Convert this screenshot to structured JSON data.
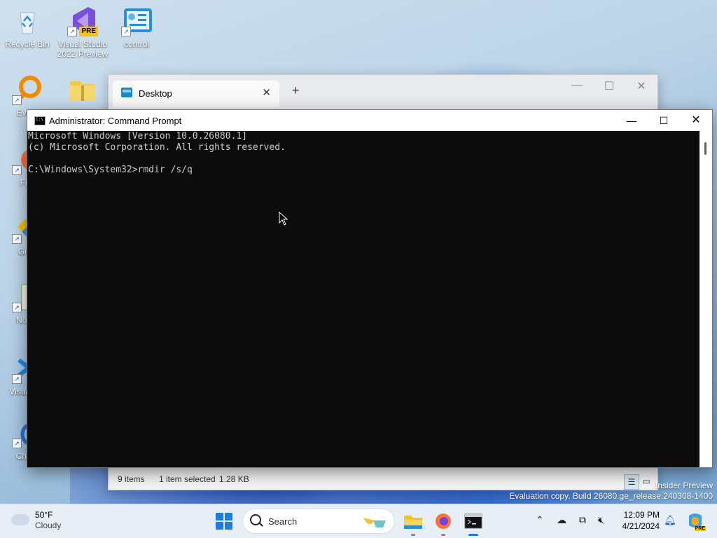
{
  "desktop": {
    "icons": [
      {
        "label": "Recycle Bin"
      },
      {
        "label": "Visual Studio 2022 Preview",
        "badge": "PRE"
      },
      {
        "label": "control"
      },
      {
        "label": "Every"
      },
      {
        "label": "Fire"
      },
      {
        "label": "Git B"
      },
      {
        "label": "Notep"
      },
      {
        "label": "Visual Co"
      },
      {
        "label": "Chron"
      }
    ]
  },
  "explorer": {
    "tab_label": "Desktop",
    "tab_close": "✕",
    "new_tab": "+",
    "status_items": "9 items",
    "status_selected": "1 item selected",
    "status_size": "1.28 KB"
  },
  "cmd": {
    "title": "Administrator: Command Prompt",
    "lines": [
      "Microsoft Windows [Version 10.0.26080.1]",
      "(c) Microsoft Corporation. All rights reserved.",
      "",
      "C:\\Windows\\System32>rmdir /s/q"
    ]
  },
  "watermark": {
    "line1": "Insider Preview",
    "line2": "Evaluation copy. Build 26080.ge_release.240308-1400"
  },
  "taskbar": {
    "weather_temp": "50°F",
    "weather_cond": "Cloudy",
    "search_placeholder": "Search",
    "time": "12:09 PM",
    "date": "4/21/2024",
    "copilot_badge": "PRE"
  },
  "colors": {
    "accent": "#1a7de0",
    "cmd_bg": "#0c0c0c",
    "cmd_fg": "#cccccc"
  }
}
